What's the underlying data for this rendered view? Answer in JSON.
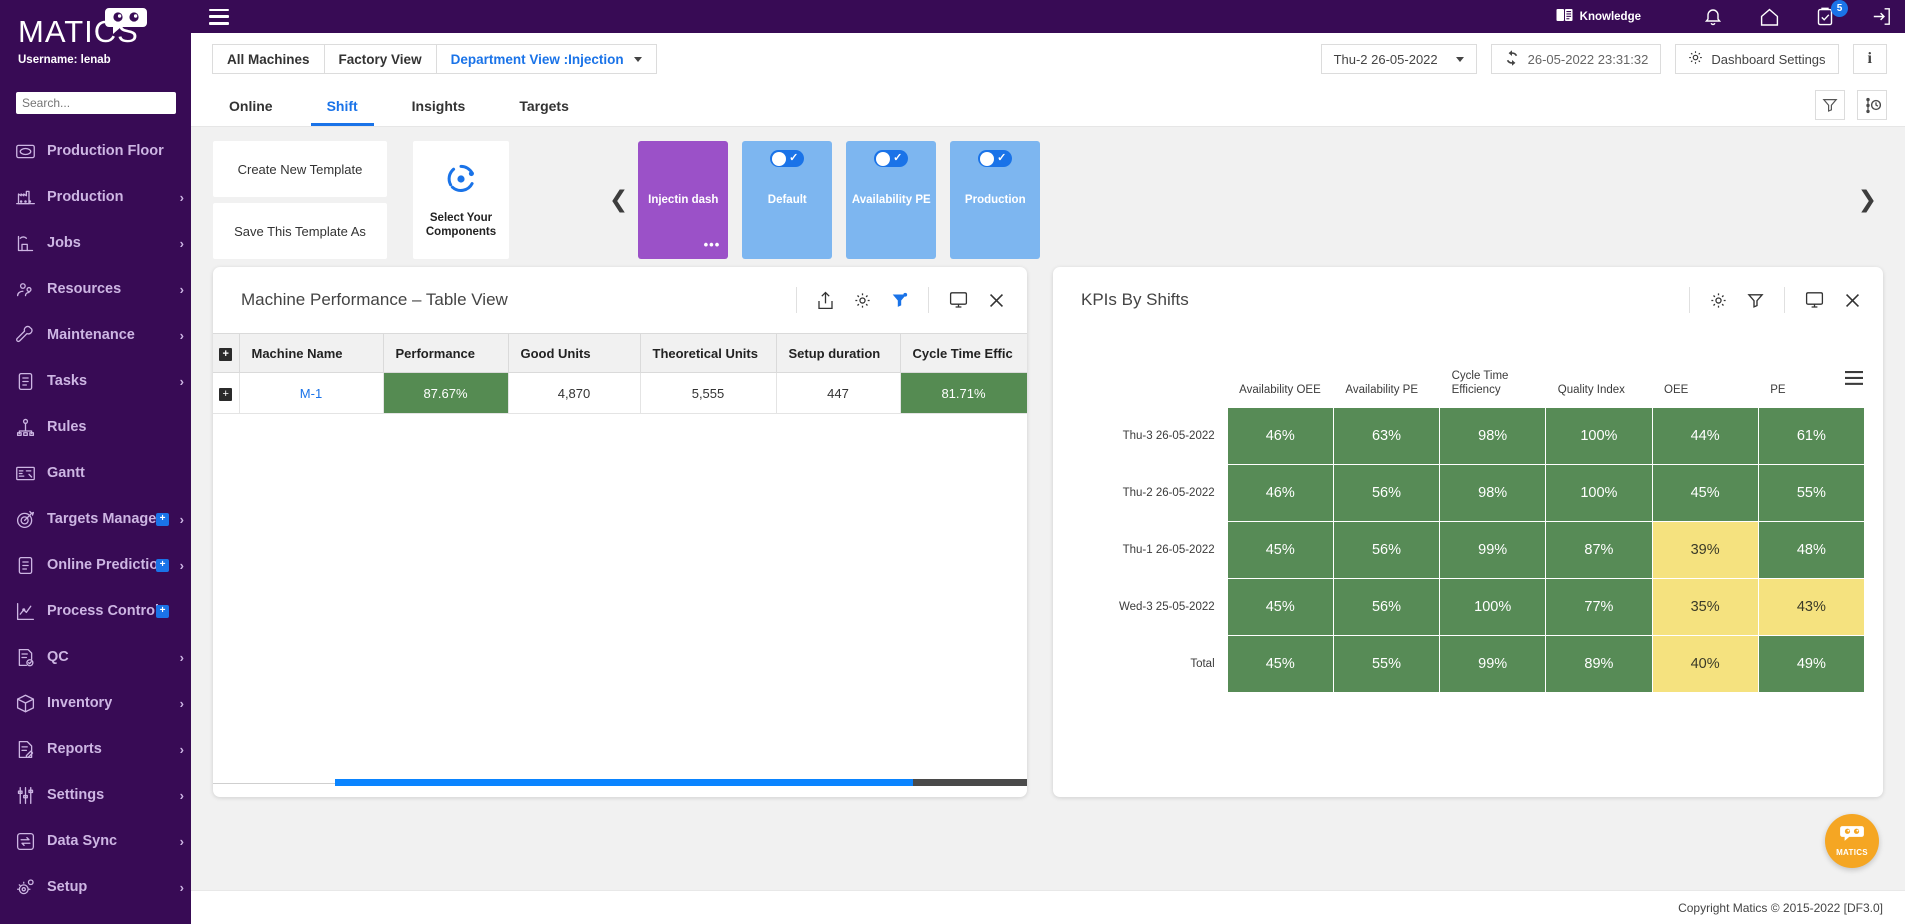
{
  "sidebar": {
    "brand": "MATICS",
    "username_label": "Username: lenab",
    "search_placeholder": "Search...",
    "items": [
      {
        "label": "Production Floor",
        "icon": "production-floor-icon",
        "badge": null,
        "caret": false
      },
      {
        "label": "Production",
        "icon": "factory-icon",
        "badge": null,
        "caret": true
      },
      {
        "label": "Jobs",
        "icon": "jobs-icon",
        "badge": null,
        "caret": true
      },
      {
        "label": "Resources",
        "icon": "resources-icon",
        "badge": null,
        "caret": true
      },
      {
        "label": "Maintenance",
        "icon": "wrench-icon",
        "badge": null,
        "caret": true
      },
      {
        "label": "Tasks",
        "icon": "clipboard-icon",
        "badge": null,
        "caret": true
      },
      {
        "label": "Rules",
        "icon": "rules-icon",
        "badge": null,
        "caret": false
      },
      {
        "label": "Gantt",
        "icon": "gantt-icon",
        "badge": null,
        "caret": false
      },
      {
        "label": "Targets Manage...",
        "icon": "target-icon",
        "badge": "+",
        "caret": true
      },
      {
        "label": "Online Prediction",
        "icon": "clipboard-icon",
        "badge": "+",
        "caret": true
      },
      {
        "label": "Process Control",
        "icon": "chart-line-icon",
        "badge": "+",
        "caret": false
      },
      {
        "label": "QC",
        "icon": "qc-icon",
        "badge": null,
        "caret": true
      },
      {
        "label": "Inventory",
        "icon": "box-icon",
        "badge": null,
        "caret": true
      },
      {
        "label": "Reports",
        "icon": "report-icon",
        "badge": null,
        "caret": true
      },
      {
        "label": "Settings",
        "icon": "sliders-icon",
        "badge": null,
        "caret": true
      },
      {
        "label": "Data Sync",
        "icon": "data-sync-icon",
        "badge": null,
        "caret": true
      },
      {
        "label": "Setup",
        "icon": "setup-gear-icon",
        "badge": null,
        "caret": true
      }
    ]
  },
  "topbar": {
    "knowledge_label": "Knowledge",
    "notification_count": "5"
  },
  "toolbar": {
    "all_machines": "All Machines",
    "factory_view": "Factory View",
    "department_view": "Department View :Injection",
    "shift_selector": "Thu-2 26-05-2022",
    "refresh_time": "26-05-2022 23:31:32",
    "dashboard_settings": "Dashboard Settings",
    "info_label": "i"
  },
  "subtabs": [
    {
      "label": "Online",
      "active": false
    },
    {
      "label": "Shift",
      "active": true
    },
    {
      "label": "Insights",
      "active": false
    },
    {
      "label": "Targets",
      "active": false
    }
  ],
  "templates": {
    "create_new": "Create New Template",
    "save_as": "Save This Template As",
    "components_label": "Select Your Components",
    "cards": [
      {
        "label": "Injectin dash",
        "selected": true,
        "toggle": false,
        "dots": "•••"
      },
      {
        "label": "Default",
        "selected": false,
        "toggle": true
      },
      {
        "label": "Availability PE",
        "selected": false,
        "toggle": true
      },
      {
        "label": "Production",
        "selected": false,
        "toggle": true
      }
    ]
  },
  "machine_panel": {
    "title": "Machine Performance – Table View",
    "columns": [
      "Machine Name",
      "Performance",
      "Good Units",
      "Theoretical Units",
      "Setup duration",
      "Cycle Time Effic"
    ],
    "rows": [
      {
        "machine_name": "M-1",
        "performance": "87.67%",
        "good_units": "4,870",
        "theoretical_units": "5,555",
        "setup_duration": "447",
        "cycle_time_efficiency": "81.71%"
      }
    ]
  },
  "kpi_panel": {
    "title": "KPIs By Shifts"
  },
  "footer": {
    "copyright": "Copyright Matics © 2015-2022 [DF3.0]"
  },
  "chat": {
    "label": "MATICS"
  },
  "colors": {
    "sidebar_bg": "#380b55",
    "accent_blue": "#1a73e8",
    "green_cell": "#578b56",
    "yellow_cell": "#f5e27f",
    "selected_card": "#9b51c8",
    "normal_card": "#7db6f0",
    "chat_orange": "#f5a623"
  },
  "chart_data": {
    "type": "heatmap",
    "title": "KPIs By Shifts",
    "categories": [
      "Availability OEE",
      "Availability PE",
      "Cycle Time Efficiency",
      "Quality Index",
      "OEE",
      "PE"
    ],
    "rows": [
      "Thu-3 26-05-2022",
      "Thu-2 26-05-2022",
      "Thu-1 26-05-2022",
      "Wed-3 25-05-2022",
      "Total"
    ],
    "values": [
      [
        "46%",
        "63%",
        "98%",
        "100%",
        "44%",
        "61%"
      ],
      [
        "46%",
        "56%",
        "98%",
        "100%",
        "45%",
        "55%"
      ],
      [
        "45%",
        "56%",
        "99%",
        "87%",
        "39%",
        "48%"
      ],
      [
        "45%",
        "56%",
        "100%",
        "77%",
        "35%",
        "43%"
      ],
      [
        "45%",
        "55%",
        "99%",
        "89%",
        "40%",
        "49%"
      ]
    ],
    "cell_colors": [
      [
        "green",
        "green",
        "green",
        "green",
        "green",
        "green"
      ],
      [
        "green",
        "green",
        "green",
        "green",
        "green",
        "green"
      ],
      [
        "green",
        "green",
        "green",
        "green",
        "yellow",
        "green"
      ],
      [
        "green",
        "green",
        "green",
        "green",
        "yellow",
        "yellow"
      ],
      [
        "green",
        "green",
        "green",
        "green",
        "yellow",
        "green"
      ]
    ],
    "legend": [],
    "xlabel": "",
    "ylabel": ""
  }
}
